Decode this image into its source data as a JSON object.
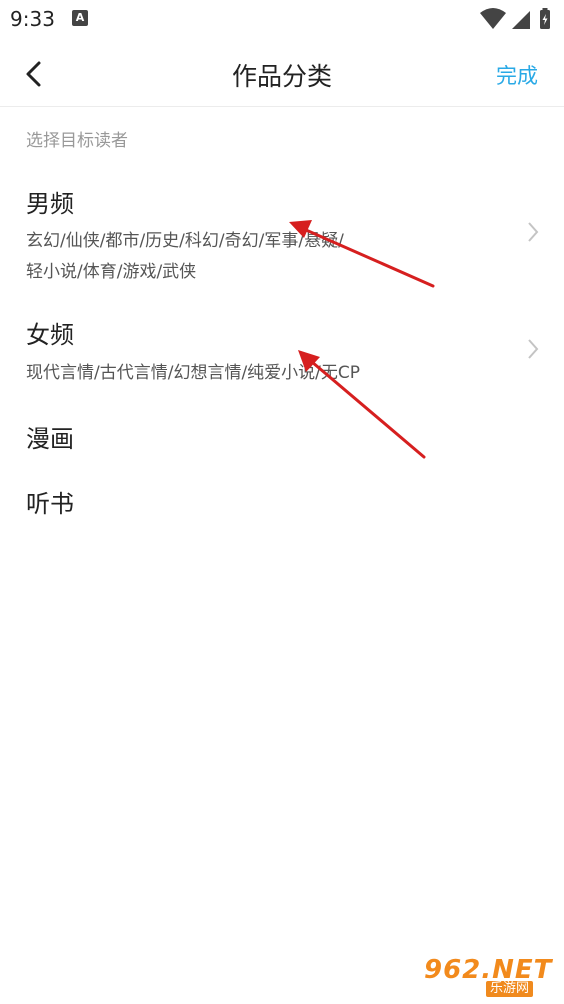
{
  "status_bar": {
    "time": "9:33",
    "notification_icon": "A"
  },
  "header": {
    "title": "作品分类",
    "done_label": "完成"
  },
  "content": {
    "hint": "选择目标读者",
    "categories": [
      {
        "title": "男频",
        "subtitle_line1": "玄幻/仙侠/都市/历史/科幻/奇幻/军事/悬疑/",
        "subtitle_line2": "轻小说/体育/游戏/武侠"
      },
      {
        "title": "女频",
        "subtitle_line1": "现代言情/古代言情/幻想言情/纯爱小说/无CP"
      },
      {
        "title": "漫画"
      },
      {
        "title": "听书"
      }
    ]
  },
  "watermark": {
    "main": "962.NET",
    "sub": "乐游网"
  },
  "colors": {
    "accent": "#29a9e6",
    "arrow": "#d61f1f",
    "hint_text": "#999999"
  },
  "icons": {
    "back": "back-arrow-icon",
    "chevron": "chevron-right-icon",
    "wifi": "wifi-icon",
    "signal": "signal-icon",
    "battery": "battery-icon"
  }
}
